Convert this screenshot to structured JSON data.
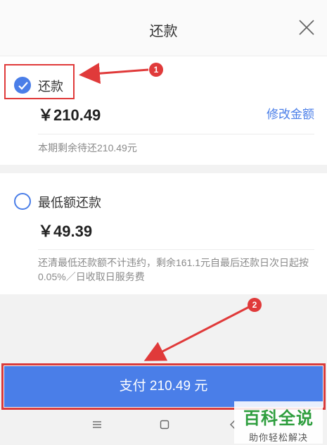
{
  "header": {
    "title": "还款"
  },
  "options": [
    {
      "label": "还款",
      "amount": "￥210.49",
      "note": "本期剩余待还210.49元",
      "selected": true,
      "edit_label": "修改金额"
    },
    {
      "label": "最低额还款",
      "amount": "￥49.39",
      "note": "还清最低还款额不计违约，剩余161.1元自最后还款日次日起按0.05%／日收取日服务费",
      "selected": false
    }
  ],
  "pay_button": {
    "label": "支付 210.49 元"
  },
  "annotations": {
    "marker1": "1",
    "marker2": "2"
  },
  "watermark": {
    "main": "百科全说",
    "sub": "助你轻松解决"
  },
  "colors": {
    "accent": "#4a7ee8",
    "annotation": "#e03a3a",
    "watermark": "#2e9e3e"
  },
  "icons": {
    "close": "close-icon",
    "check": "check-icon",
    "menu": "menu-icon",
    "home": "home-icon",
    "back": "back-icon"
  }
}
